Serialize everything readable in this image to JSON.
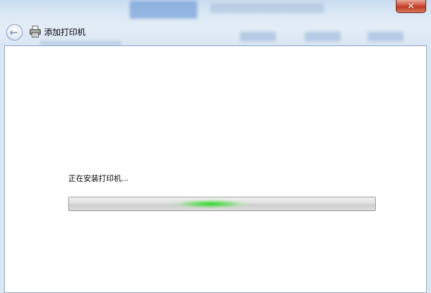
{
  "window": {
    "title": "添加打印机",
    "close_glyph": "✕"
  },
  "nav": {
    "back_glyph": "←"
  },
  "icons": {
    "back": "back-arrow-icon",
    "printer": "printer-icon",
    "close": "close-icon"
  },
  "content": {
    "status_text": "正在安装打印机..."
  },
  "progress": {
    "mode": "indeterminate",
    "glow_color": "#1edc1e"
  },
  "colors": {
    "close_button": "#c8452c",
    "content_bg": "#ffffff"
  }
}
